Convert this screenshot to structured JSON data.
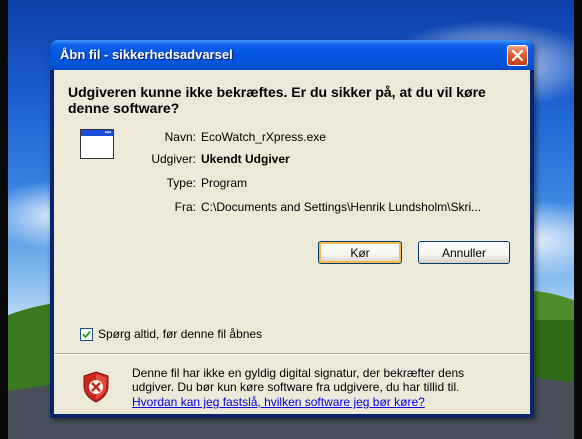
{
  "dialog": {
    "title": "Åbn fil - sikkerhedsadvarsel",
    "heading": "Udgiveren kunne ikke bekræftes.  Er du sikker på, at du vil køre denne software?",
    "fields": [
      {
        "label": "Navn:",
        "value": "EcoWatch_rXpress.exe"
      },
      {
        "label": "Udgiver:",
        "value": "Ukendt Udgiver"
      },
      {
        "label": "Type:",
        "value": "Program"
      },
      {
        "label": "Fra:",
        "value": "C:\\Documents and Settings\\Henrik Lundsholm\\Skri..."
      }
    ],
    "buttons": {
      "run": "Kør",
      "cancel": "Annuller"
    },
    "checkbox": {
      "label": "Spørg altid, før denne fil åbnes",
      "checked": true
    },
    "warning": {
      "line1": "Denne fil har ikke en gyldig digital signatur, der bekræfter dens",
      "line2": "udgiver.  Du bør kun køre software fra udgivere, du har tillid til.",
      "link": "Hvordan kan jeg fastslå, hvilken software jeg bør køre?"
    }
  },
  "icons": {
    "close": "close-icon",
    "app": "program-window-icon",
    "shield": "security-shield-icon",
    "check": "checkmark-icon"
  },
  "colors": {
    "titlebar": "#0554e3",
    "client_bg": "#ece9d8",
    "close_button": "#e05a2c",
    "link": "#0000e6",
    "shield": "#c8261b"
  }
}
